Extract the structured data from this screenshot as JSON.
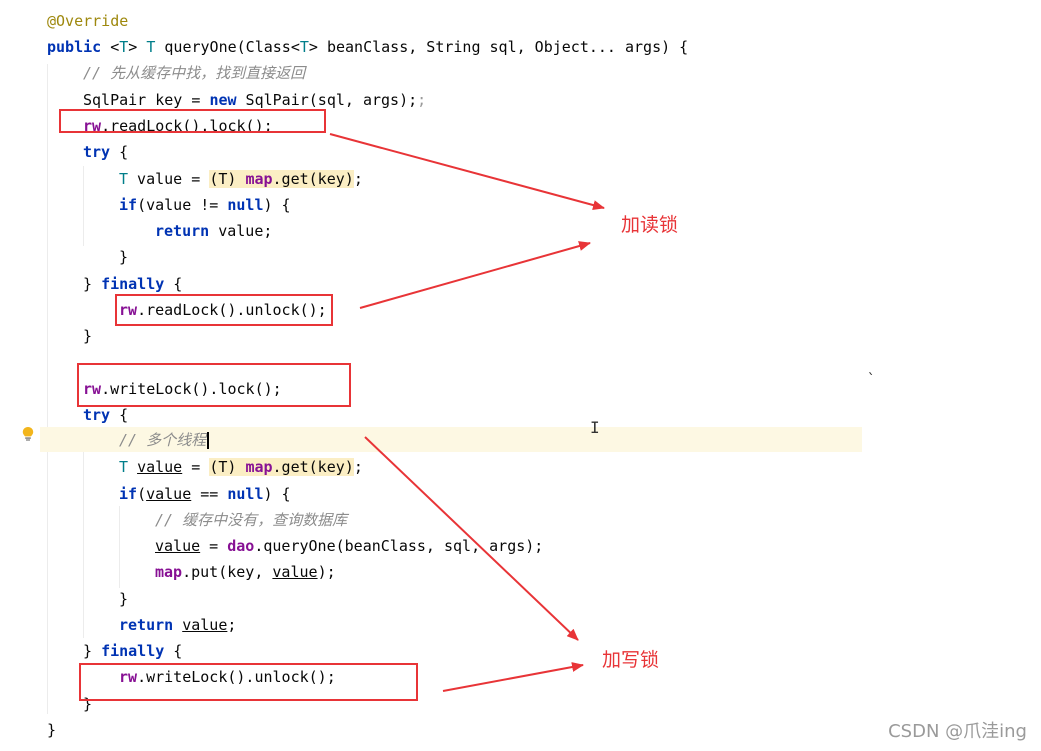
{
  "code": {
    "l1_annotation": "@Override",
    "l2": {
      "kw_public": "public",
      "generic_open": " <",
      "generic_t": "T",
      "generic_close": "> ",
      "ret_t": "T",
      "signature": " queryOne(Class<",
      "sig_t": "T",
      "signature_rest": "> beanClass, String sql, Object... args) {"
    },
    "l3_comment": "// 先从缓存中找，找到直接返回",
    "l4": {
      "pre": "SqlPair key = ",
      "kw_new": "new",
      "post": " SqlPair(sql, args);",
      "extra_semicolon": ";"
    },
    "l5": {
      "field": "rw",
      "rest": ".readLock().lock();"
    },
    "l6": {
      "kw_try": "try",
      "rest": " {"
    },
    "l7": {
      "type_t": "T",
      "pre": " value = ",
      "cast": "(T) ",
      "field": "map",
      "rest": ".get(key)",
      "semi": ";"
    },
    "l8": {
      "kw_if": "if",
      "pre": "(value != ",
      "kw_null": "null",
      "post": ") {"
    },
    "l9": {
      "kw_return": "return",
      "rest": " value;"
    },
    "l10_brace": "}",
    "l11": {
      "brace": "} ",
      "kw_finally": "finally",
      "rest": " {"
    },
    "l12": {
      "field": "rw",
      "rest": ".readLock().unlock();"
    },
    "l13_brace": "}",
    "l15": {
      "field": "rw",
      "rest": ".writeLock().lock();"
    },
    "l16": {
      "kw_try": "try",
      "rest": " {"
    },
    "l17_comment": "// 多个线程",
    "l18": {
      "type_t": "T",
      "sp": " ",
      "var": "value",
      "eq": " = ",
      "cast": "(T) ",
      "field": "map",
      "rest": ".get(key)",
      "semi": ";"
    },
    "l19": {
      "kw_if": "if",
      "open": "(",
      "var": "value",
      "mid": " == ",
      "kw_null": "null",
      "post": ") {"
    },
    "l20_comment": "// 缓存中没有，查询数据库",
    "l21": {
      "var": "value",
      "eq": " = ",
      "field": "dao",
      "rest": ".queryOne(beanClass, sql, args);"
    },
    "l22": {
      "field": "map",
      "pre": ".put(key, ",
      "var": "value",
      "post": ");"
    },
    "l23_brace": "}",
    "l24": {
      "kw_return": "return",
      "sp": " ",
      "var": "value",
      "semi": ";"
    },
    "l25": {
      "brace": "} ",
      "kw_finally": "finally",
      "rest": " {"
    },
    "l26": {
      "field": "rw",
      "rest": ".writeLock().unlock();"
    },
    "l27_brace": "}",
    "l28_brace": "}"
  },
  "annotations": {
    "read_lock_label": "加读锁",
    "write_lock_label": "加写锁",
    "color": "#e83437"
  },
  "stray_mark": "`",
  "watermark": "CSDN @爪洼ing",
  "icons": {
    "gutter": "lightbulb-icon",
    "cursor": "text-cursor-icon"
  }
}
